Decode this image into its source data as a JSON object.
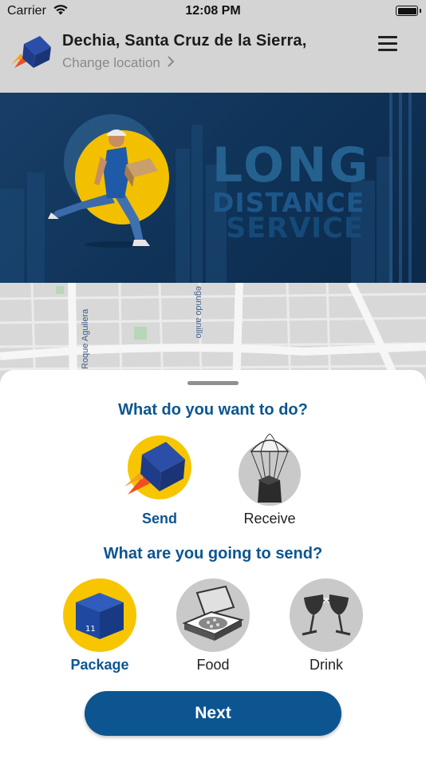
{
  "status_bar": {
    "carrier": "Carrier",
    "time": "12:08 PM"
  },
  "header": {
    "location_title": "Dechia, Santa Cruz de la Sierra,",
    "change_location": "Change location",
    "icons": [
      "app-logo-icon",
      "chevron-right-icon",
      "hamburger-menu-icon"
    ]
  },
  "banner": {
    "line1": "LONG",
    "line2": "DISTANCE",
    "line3": "SERVICE"
  },
  "map": {
    "street_labels": [
      "Roque Aguilera",
      "egundo anillo"
    ]
  },
  "sheet": {
    "question_action": "What do you want to do?",
    "actions": [
      {
        "label": "Send",
        "icon": "rocket-box-icon",
        "selected": true
      },
      {
        "label": "Receive",
        "icon": "parachute-box-icon",
        "selected": false
      }
    ],
    "question_item": "What are you going to send?",
    "items": [
      {
        "label": "Package",
        "icon": "package-box-icon",
        "selected": true
      },
      {
        "label": "Food",
        "icon": "pizza-box-icon",
        "selected": false
      },
      {
        "label": "Drink",
        "icon": "wine-glasses-icon",
        "selected": false
      }
    ],
    "next_label": "Next"
  },
  "colors": {
    "brand_blue": "#0d5590",
    "accent_yellow": "#f7c600",
    "banner_navy": "#0f3257",
    "unselected_grey": "#c9c9c9"
  }
}
